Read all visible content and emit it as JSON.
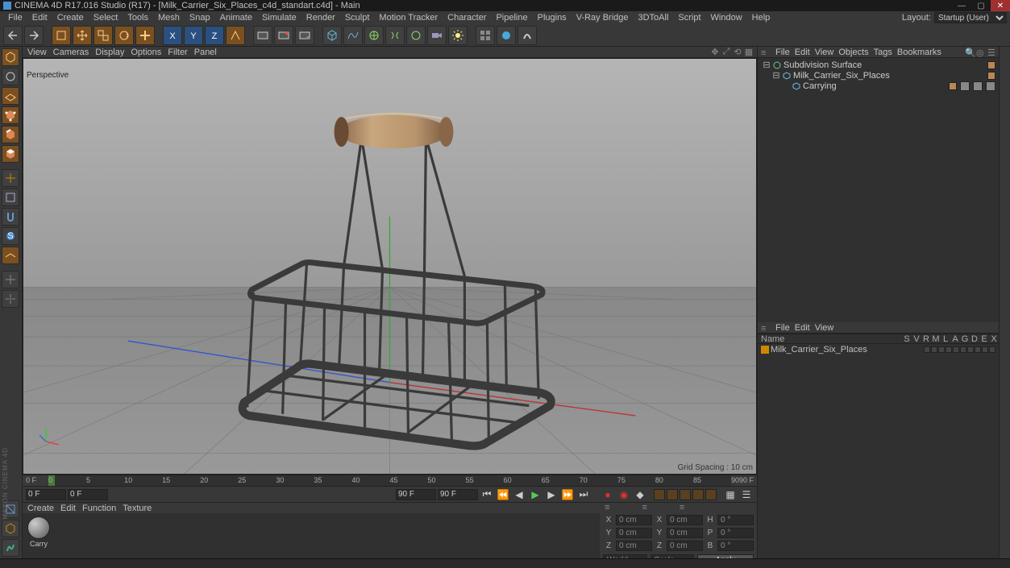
{
  "title": "CINEMA 4D R17.016 Studio (R17) - [Milk_Carrier_Six_Places_c4d_standart.c4d] - Main",
  "menubar": [
    "File",
    "Edit",
    "Create",
    "Select",
    "Tools",
    "Mesh",
    "Snap",
    "Animate",
    "Simulate",
    "Render",
    "Sculpt",
    "Motion Tracker",
    "Character",
    "Pipeline",
    "Plugins",
    "V-Ray Bridge",
    "3DToAll",
    "Script",
    "Window",
    "Help"
  ],
  "layout_label": "Layout:",
  "layout_value": "Startup (User)",
  "vp_menubar": [
    "View",
    "Cameras",
    "Display",
    "Options",
    "Filter",
    "Panel"
  ],
  "vp_label": "Perspective",
  "grid_spacing": "Grid Spacing : 10 cm",
  "timeline": {
    "start": 0,
    "end": 90,
    "ticks": [
      0,
      5,
      10,
      15,
      20,
      25,
      30,
      35,
      40,
      45,
      50,
      55,
      60,
      65,
      70,
      75,
      80,
      85,
      90
    ],
    "left_label": "0 F",
    "right_label": "90 F"
  },
  "playbar": {
    "frame_start": "0 F",
    "frame_cur": "0 F",
    "frame_mid": "90 F",
    "frame_end": "90 F"
  },
  "mat_menubar": [
    "Create",
    "Edit",
    "Function",
    "Texture"
  ],
  "materials": [
    {
      "name": "Carry"
    }
  ],
  "obj_menubar": [
    "File",
    "Edit",
    "View",
    "Objects",
    "Tags",
    "Bookmarks"
  ],
  "objects": [
    {
      "depth": 0,
      "expand": "⊟",
      "icon": "subdiv",
      "name": "Subdivision Surface",
      "dot": true,
      "tags": 0
    },
    {
      "depth": 1,
      "expand": "⊟",
      "icon": "poly",
      "name": "Milk_Carrier_Six_Places",
      "dot": true,
      "tags": 0
    },
    {
      "depth": 2,
      "expand": "",
      "icon": "poly",
      "name": "Carrying",
      "dot": true,
      "tags": 3
    }
  ],
  "coord": {
    "rows": [
      {
        "a": "X",
        "av": "0 cm",
        "b": "X",
        "bv": "0 cm",
        "c": "H",
        "cv": "0 °"
      },
      {
        "a": "Y",
        "av": "0 cm",
        "b": "Y",
        "bv": "0 cm",
        "c": "P",
        "cv": "0 °"
      },
      {
        "a": "Z",
        "av": "0 cm",
        "b": "Z",
        "bv": "0 cm",
        "c": "B",
        "cv": "0 °"
      }
    ],
    "mode1": "World",
    "mode2": "Scale",
    "apply": "Apply"
  },
  "attr_menubar": [
    "File",
    "Edit",
    "View"
  ],
  "attr_header": {
    "name": "Name",
    "cols": [
      "S",
      "V",
      "R",
      "M",
      "L",
      "A",
      "G",
      "D",
      "E",
      "X"
    ]
  },
  "attr_row": {
    "name": "Milk_Carrier_Six_Places"
  },
  "maxon": "MAXON CINEMA 4D"
}
